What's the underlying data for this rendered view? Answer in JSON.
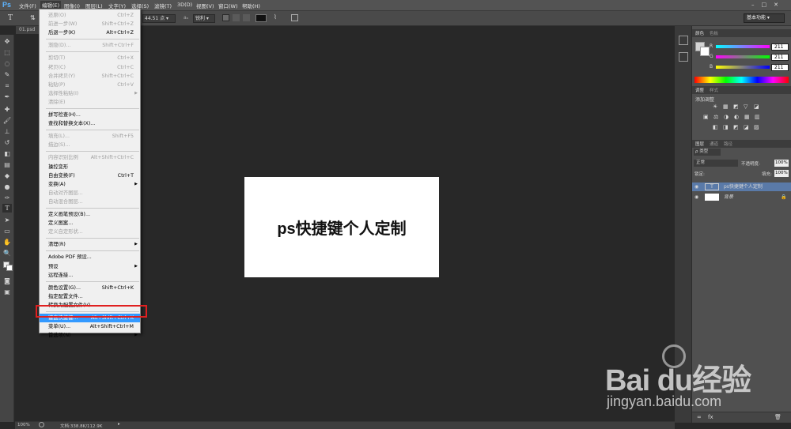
{
  "menubar": {
    "logo": "Ps",
    "items": [
      "文件(F)",
      "编辑(E)",
      "图像(I)",
      "图层(L)",
      "文字(Y)",
      "选择(S)",
      "滤镜(T)",
      "3D(D)",
      "视图(V)",
      "窗口(W)",
      "帮助(H)"
    ],
    "window_controls": [
      "–",
      "□",
      "✕"
    ]
  },
  "options": {
    "zoom": "44.51 点",
    "aa": "锐利",
    "workspace": "基本功能"
  },
  "document": {
    "tab": "01.psd @",
    "canvas_text": "ps快捷键个人定制"
  },
  "status": {
    "zoom": "100%",
    "doc": "文档:338.8K/112.9K"
  },
  "edit_menu": [
    {
      "label": "还原(O)",
      "shortcut": "Ctrl+Z",
      "disabled": true
    },
    {
      "label": "前进一步(W)",
      "shortcut": "Shift+Ctrl+Z",
      "disabled": true
    },
    {
      "label": "后退一步(K)",
      "shortcut": "Alt+Ctrl+Z",
      "disabled": false
    },
    {
      "sep": true
    },
    {
      "label": "渐隐(D)...",
      "shortcut": "Shift+Ctrl+F",
      "disabled": true
    },
    {
      "sep": true
    },
    {
      "label": "剪切(T)",
      "shortcut": "Ctrl+X",
      "disabled": true
    },
    {
      "label": "拷贝(C)",
      "shortcut": "Ctrl+C",
      "disabled": true
    },
    {
      "label": "合并拷贝(Y)",
      "shortcut": "Shift+Ctrl+C",
      "disabled": true
    },
    {
      "label": "粘贴(P)",
      "shortcut": "Ctrl+V",
      "disabled": true
    },
    {
      "label": "选择性粘贴(I)",
      "shortcut": "",
      "disabled": true,
      "sub": true
    },
    {
      "label": "清除(E)",
      "shortcut": "",
      "disabled": true
    },
    {
      "sep": true
    },
    {
      "label": "拼写检查(H)...",
      "shortcut": "",
      "disabled": false
    },
    {
      "label": "查找和替换文本(X)...",
      "shortcut": "",
      "disabled": false
    },
    {
      "sep": true
    },
    {
      "label": "填充(L)...",
      "shortcut": "Shift+F5",
      "disabled": true
    },
    {
      "label": "描边(S)...",
      "shortcut": "",
      "disabled": true
    },
    {
      "sep": true
    },
    {
      "label": "内容识别比例",
      "shortcut": "Alt+Shift+Ctrl+C",
      "disabled": true
    },
    {
      "label": "操控变形",
      "shortcut": "",
      "disabled": false
    },
    {
      "label": "自由变换(F)",
      "shortcut": "Ctrl+T",
      "disabled": false
    },
    {
      "label": "变换(A)",
      "shortcut": "",
      "disabled": false,
      "sub": true
    },
    {
      "label": "自动对齐图层...",
      "shortcut": "",
      "disabled": true
    },
    {
      "label": "自动混合图层...",
      "shortcut": "",
      "disabled": true
    },
    {
      "sep": true
    },
    {
      "label": "定义画笔预设(B)...",
      "shortcut": "",
      "disabled": false
    },
    {
      "label": "定义图案...",
      "shortcut": "",
      "disabled": false
    },
    {
      "label": "定义自定形状...",
      "shortcut": "",
      "disabled": true
    },
    {
      "sep": true
    },
    {
      "label": "清理(R)",
      "shortcut": "",
      "disabled": false,
      "sub": true
    },
    {
      "sep": true
    },
    {
      "label": "Adobe PDF 预设...",
      "shortcut": "",
      "disabled": false
    },
    {
      "label": "预设",
      "shortcut": "",
      "disabled": false,
      "sub": true
    },
    {
      "label": "远程连接...",
      "shortcut": "",
      "disabled": false
    },
    {
      "sep": true
    },
    {
      "label": "颜色设置(G)...",
      "shortcut": "Shift+Ctrl+K",
      "disabled": false
    },
    {
      "label": "指定配置文件...",
      "shortcut": "",
      "disabled": false
    },
    {
      "label": "转换为配置文件(V)...",
      "shortcut": "",
      "disabled": false
    },
    {
      "sep": true
    },
    {
      "label": "键盘快捷键...",
      "shortcut": "Alt+Shift+Ctrl+K",
      "disabled": false,
      "hl": true
    },
    {
      "label": "菜单(U)...",
      "shortcut": "Alt+Shift+Ctrl+M",
      "disabled": false
    },
    {
      "label": "首选项(N)",
      "shortcut": "",
      "disabled": false,
      "sub": true
    }
  ],
  "color_panel": {
    "tabs": [
      "颜色",
      "色板"
    ],
    "channels": [
      {
        "name": "R",
        "value": "211"
      },
      {
        "name": "G",
        "value": "211"
      },
      {
        "name": "B",
        "value": "211"
      }
    ]
  },
  "adjust_panel": {
    "tabs": [
      "调整",
      "样式"
    ],
    "title": "添加调整"
  },
  "layers_panel": {
    "tabs": [
      "图层",
      "通道",
      "路径"
    ],
    "kind": "ρ 类型",
    "blend": "正常",
    "opacity_label": "不透明度:",
    "opacity": "100%",
    "lock_label": "锁定:",
    "fill_label": "填充:",
    "fill": "100%",
    "layers": [
      {
        "name": "ps快捷键个人定制",
        "type": "text"
      },
      {
        "name": "背景",
        "type": "bg"
      }
    ]
  },
  "watermark": {
    "brand": "Bai du经验",
    "url": "jingyan.baidu.com"
  }
}
